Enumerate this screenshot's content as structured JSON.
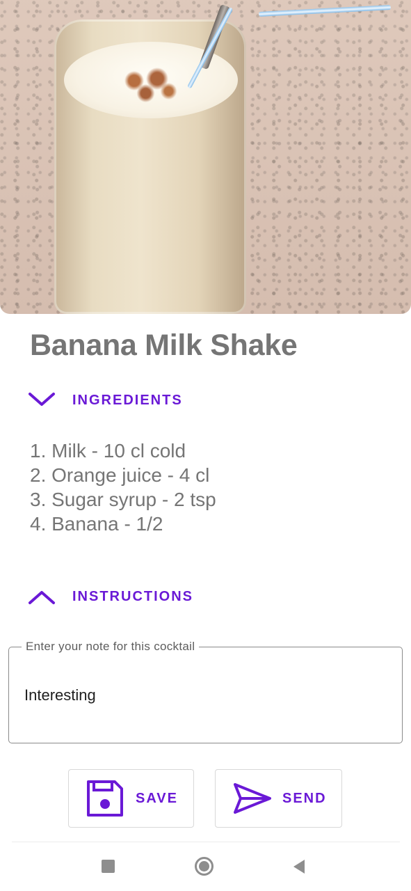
{
  "hero": {
    "image_alt": "banana-milk-shake-photo"
  },
  "title": "Banana Milk Shake",
  "ingredients_section": {
    "label": "INGREDIENTS",
    "icon": "chevron-down-icon",
    "items": [
      "1. Milk - 10 cl cold",
      "2. Orange juice - 4 cl",
      "3. Sugar syrup - 2 tsp",
      "4. Banana - 1/2"
    ]
  },
  "instructions_section": {
    "label": "INSTRUCTIONS",
    "icon": "chevron-up-icon"
  },
  "note_field": {
    "label": "Enter your note for this cocktail",
    "value": "Interesting"
  },
  "actions": {
    "save_label": "SAVE",
    "save_icon": "floppy-disk-icon",
    "send_label": "SEND",
    "send_icon": "send-icon"
  },
  "navbar": {
    "recents_icon": "square-icon",
    "home_icon": "circle-icon",
    "back_icon": "triangle-back-icon"
  },
  "colors": {
    "accent": "#6a19d6",
    "text_gray": "#757575",
    "outline": "#8a8a8a"
  }
}
